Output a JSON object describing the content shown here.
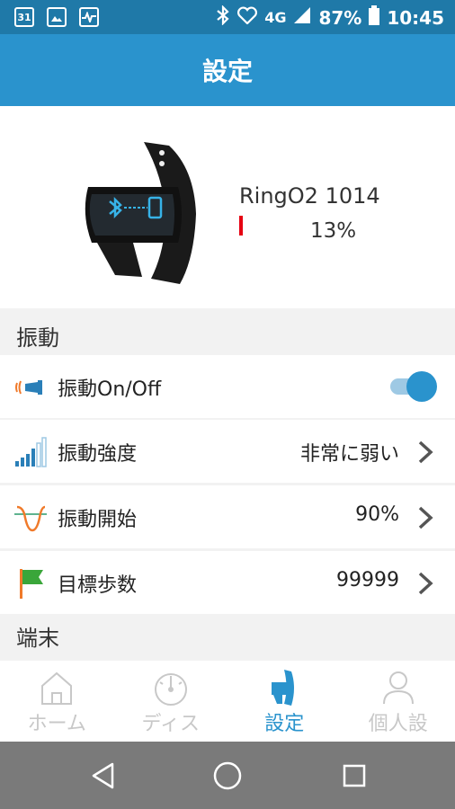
{
  "status_bar": {
    "calendar_day": "31",
    "network": "4G",
    "battery": "87%",
    "time": "10:45"
  },
  "header": {
    "title": "設定"
  },
  "device": {
    "name": "RingO2 1014",
    "battery_percent": "13%",
    "battery_level": 0.13
  },
  "sections": {
    "vibration": "振動",
    "device": "端末"
  },
  "rows": [
    {
      "label": "振動On/Off",
      "toggle_on": true
    },
    {
      "label": "振動強度",
      "value": "非常に弱い"
    },
    {
      "label": "振動開始",
      "value": "90%"
    },
    {
      "label": "目標歩数",
      "value": "99999"
    }
  ],
  "bottom_nav": [
    {
      "label": "ホーム",
      "icon": "home-icon",
      "active": false
    },
    {
      "label": "ディス",
      "icon": "gauge-icon",
      "active": false
    },
    {
      "label": "設定",
      "icon": "settings-ring-icon",
      "active": true
    },
    {
      "label": "個人設",
      "icon": "person-icon",
      "active": false
    }
  ],
  "colors": {
    "accent": "#2a93cd",
    "status_bar": "#1f79a8",
    "battery_low": "#e60012",
    "goal_flag": "#3aa63a"
  }
}
